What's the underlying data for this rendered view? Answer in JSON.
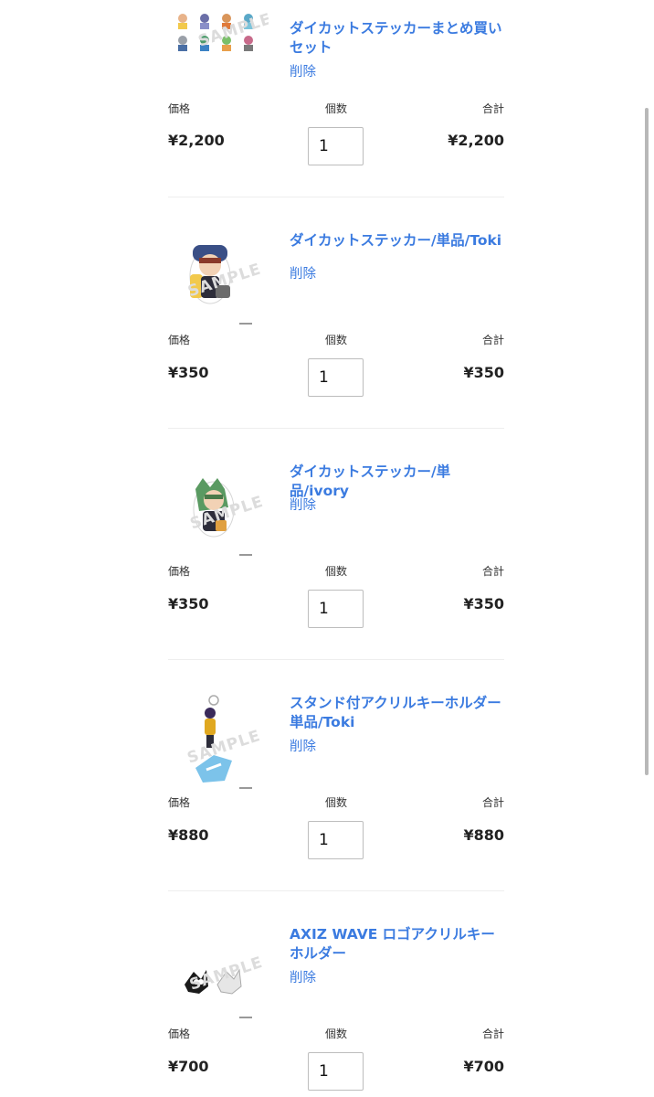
{
  "headers": {
    "price": "価格",
    "quantity": "個数",
    "total": "合計"
  },
  "remove_label": "削除",
  "watermark": "SAMPLE",
  "accent_color": "#3b7be0",
  "items": [
    {
      "name": "ダイカットステッカーまとめ買いセット",
      "price": "¥2,200",
      "quantity": "1",
      "total": "¥2,200"
    },
    {
      "name": "ダイカットステッカー/単品/Toki",
      "price": "¥350",
      "quantity": "1",
      "total": "¥350"
    },
    {
      "name": "ダイカットステッカー/単品/ivory",
      "price": "¥350",
      "quantity": "1",
      "total": "¥350"
    },
    {
      "name": "スタンド付アクリルキーホルダー単品/Toki",
      "price": "¥880",
      "quantity": "1",
      "total": "¥880"
    },
    {
      "name": "AXIZ WAVE ロゴアクリルキーホルダー",
      "price": "¥700",
      "quantity": "1",
      "total": "¥700"
    }
  ]
}
